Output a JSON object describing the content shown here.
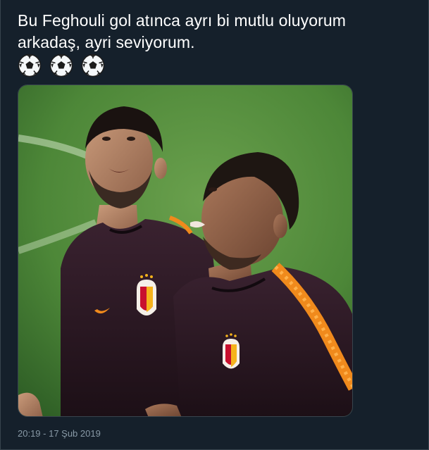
{
  "tweet": {
    "text_lines": [
      "Bu Feghouli gol atınca ayrı bi mutlu oluyorum",
      "arkadaş, ayri seviyorum."
    ],
    "emojis": [
      "soccer-ball-icon",
      "soccer-ball-icon",
      "soccer-ball-icon"
    ],
    "timestamp": "20:19 - 17 Şub 2019"
  },
  "colors": {
    "background": "#15202b",
    "text": "#ffffff",
    "muted": "#8899a6",
    "border": "#38444d",
    "pitch": "#4f8a3c",
    "jersey": "#2a1720",
    "accent_orange": "#f08a1c"
  }
}
